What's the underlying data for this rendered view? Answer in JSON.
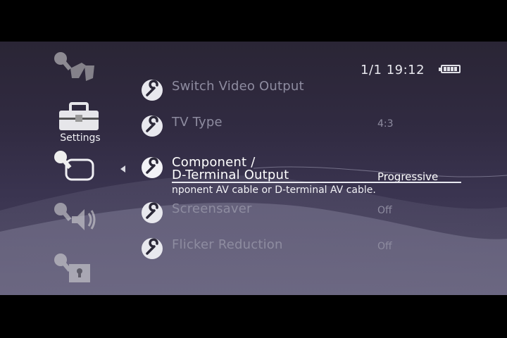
{
  "status": {
    "date": "1/1",
    "time": "19:12",
    "battery_cells": 4
  },
  "category": {
    "active_label": "Settings"
  },
  "menu": {
    "items": [
      {
        "label": "Switch Video Output",
        "value": ""
      },
      {
        "label": "TV Type",
        "value": "4:3"
      },
      {
        "label_line1": "Component /",
        "label_line2": "D-Terminal Output",
        "value": "Progressive"
      },
      {
        "label": "Screensaver",
        "value": "Off"
      },
      {
        "label": "Flicker Reduction",
        "value": "Off"
      }
    ],
    "help_text": "nponent AV cable or D-terminal AV cable."
  },
  "colors": {
    "background": "#312b42",
    "selected_text": "#ffffff",
    "dim_text": "#8e8ca0"
  },
  "icons": [
    "network-settings-icon",
    "toolbox-icon",
    "display-settings-icon",
    "sound-settings-icon",
    "security-settings-icon",
    "wrench-icon"
  ]
}
